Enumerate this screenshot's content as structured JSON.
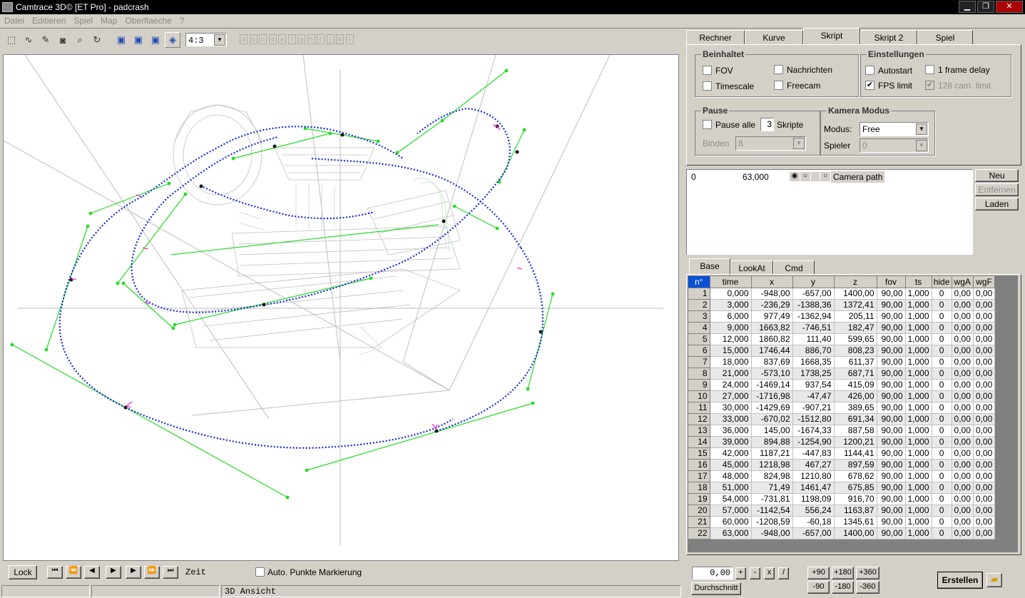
{
  "window": {
    "title": "Camtrace 3D© [ET Pro] - padcrash",
    "min_label": "▁",
    "restore_label": "❐",
    "close_label": "✕"
  },
  "menu": [
    "Datei",
    "Editieren",
    "Spiel",
    "Map",
    "Oberflaeche",
    "?"
  ],
  "toolbar": {
    "aspect": "4:3",
    "letters": [
      "a",
      "b",
      "c",
      "d",
      "e",
      "f",
      "g",
      "h",
      "i",
      "j",
      "k",
      "l"
    ]
  },
  "tabs_top": [
    "Rechner",
    "Kurve",
    "Skript",
    "Skript 2",
    "Spiel"
  ],
  "beinhaltet": {
    "title": "Beinhaltet",
    "fov": "FOV",
    "nachrichten": "Nachrichten",
    "timescale": "Timescale",
    "freecam": "Freecam"
  },
  "einstellungen": {
    "title": "Einstellungen",
    "autostart": "Autostart",
    "frame_delay": "1 frame delay",
    "fps_limit": "FPS limit",
    "cam_limit": "128 cam. limit."
  },
  "pause": {
    "title": "Pause",
    "pause_alle": "Pause alle",
    "count": "3",
    "skripte": "Skripte",
    "binden_label": "Binden",
    "binden_value": "ß"
  },
  "kamera": {
    "title": "Kamera Modus",
    "modus_label": "Modus:",
    "modus_value": "Free",
    "spieler_label": "Spieler",
    "spieler_value": "0"
  },
  "scripts_list": {
    "index": "0",
    "time": "63,000",
    "name": "Camera path"
  },
  "script_buttons": {
    "neu": "Neu",
    "entfernen": "Entfernen",
    "laden": "Laden"
  },
  "tabs_bottom": [
    "Base",
    "LookAt",
    "Cmd"
  ],
  "table": {
    "headers": [
      "n°",
      "time",
      "x",
      "y",
      "z",
      "fov",
      "ts",
      "hide",
      "wgA",
      "wgF"
    ],
    "rows": [
      [
        "1",
        "0,000",
        "-948,00",
        "-657,00",
        "1400,00",
        "90,00",
        "1,000",
        "0",
        "0,00",
        "0,00"
      ],
      [
        "2",
        "3,000",
        "-236,29",
        "-1388,36",
        "1372,41",
        "90,00",
        "1,000",
        "0",
        "0,00",
        "0,00"
      ],
      [
        "3",
        "6,000",
        "977,49",
        "-1362,94",
        "205,11",
        "90,00",
        "1,000",
        "0",
        "0,00",
        "0,00"
      ],
      [
        "4",
        "9,000",
        "1663,82",
        "-746,51",
        "182,47",
        "90,00",
        "1,000",
        "0",
        "0,00",
        "0,00"
      ],
      [
        "5",
        "12,000",
        "1860,82",
        "111,40",
        "599,65",
        "90,00",
        "1,000",
        "0",
        "0,00",
        "0,00"
      ],
      [
        "6",
        "15,000",
        "1746,44",
        "886,70",
        "808,23",
        "90,00",
        "1,000",
        "0",
        "0,00",
        "0,00"
      ],
      [
        "7",
        "18,000",
        "837,69",
        "1668,35",
        "611,37",
        "90,00",
        "1,000",
        "0",
        "0,00",
        "0,00"
      ],
      [
        "8",
        "21,000",
        "-573,10",
        "1738,25",
        "687,71",
        "90,00",
        "1,000",
        "0",
        "0,00",
        "0,00"
      ],
      [
        "9",
        "24,000",
        "-1469,14",
        "937,54",
        "415,09",
        "90,00",
        "1,000",
        "0",
        "0,00",
        "0,00"
      ],
      [
        "10",
        "27,000",
        "-1716,98",
        "-47,47",
        "426,00",
        "90,00",
        "1,000",
        "0",
        "0,00",
        "0,00"
      ],
      [
        "11",
        "30,000",
        "-1429,69",
        "-907,21",
        "389,65",
        "90,00",
        "1,000",
        "0",
        "0,00",
        "0,00"
      ],
      [
        "12",
        "33,000",
        "-670,02",
        "-1512,80",
        "691,34",
        "90,00",
        "1,000",
        "0",
        "0,00",
        "0,00"
      ],
      [
        "13",
        "36,000",
        "145,00",
        "-1674,33",
        "887,58",
        "90,00",
        "1,000",
        "0",
        "0,00",
        "0,00"
      ],
      [
        "14",
        "39,000",
        "894,88",
        "-1254,90",
        "1200,21",
        "90,00",
        "1,000",
        "0",
        "0,00",
        "0,00"
      ],
      [
        "15",
        "42,000",
        "1187,21",
        "-447,83",
        "1144,41",
        "90,00",
        "1,000",
        "0",
        "0,00",
        "0,00"
      ],
      [
        "16",
        "45,000",
        "1218,98",
        "467,27",
        "897,59",
        "90,00",
        "1,000",
        "0",
        "0,00",
        "0,00"
      ],
      [
        "17",
        "48,000",
        "824,98",
        "1210,80",
        "678,62",
        "90,00",
        "1,000",
        "0",
        "0,00",
        "0,00"
      ],
      [
        "18",
        "51,000",
        "71,49",
        "1461,47",
        "675,85",
        "90,00",
        "1,000",
        "0",
        "0,00",
        "0,00"
      ],
      [
        "19",
        "54,000",
        "-731,81",
        "1198,09",
        "916,70",
        "90,00",
        "1,000",
        "0",
        "0,00",
        "0,00"
      ],
      [
        "20",
        "57,000",
        "-1142,54",
        "556,24",
        "1163,87",
        "90,00",
        "1,000",
        "0",
        "0,00",
        "0,00"
      ],
      [
        "21",
        "60,000",
        "-1208,59",
        "-60,18",
        "1345,61",
        "90,00",
        "1,000",
        "0",
        "0,00",
        "0,00"
      ],
      [
        "22",
        "63,000",
        "-948,00",
        "-657,00",
        "1400,00",
        "90,00",
        "1,000",
        "0",
        "0,00",
        "0,00"
      ]
    ]
  },
  "bottom_controls": {
    "value": "0,00",
    "plus": "+",
    "minus": "-",
    "times": "x",
    "div": "/",
    "durchschnitt": "Durchschnitt",
    "p90": "+90",
    "p180": "+180",
    "p360": "+360",
    "m90": "-90",
    "m180": "-180",
    "m360": "-360",
    "erstellen": "Erstellen"
  },
  "view_controls": {
    "lock": "Lock",
    "zeit": "Zeit",
    "auto_punkte": "Auto. Punkte Markierung"
  },
  "statusbar": {
    "view_name": "3D Ansicht"
  }
}
